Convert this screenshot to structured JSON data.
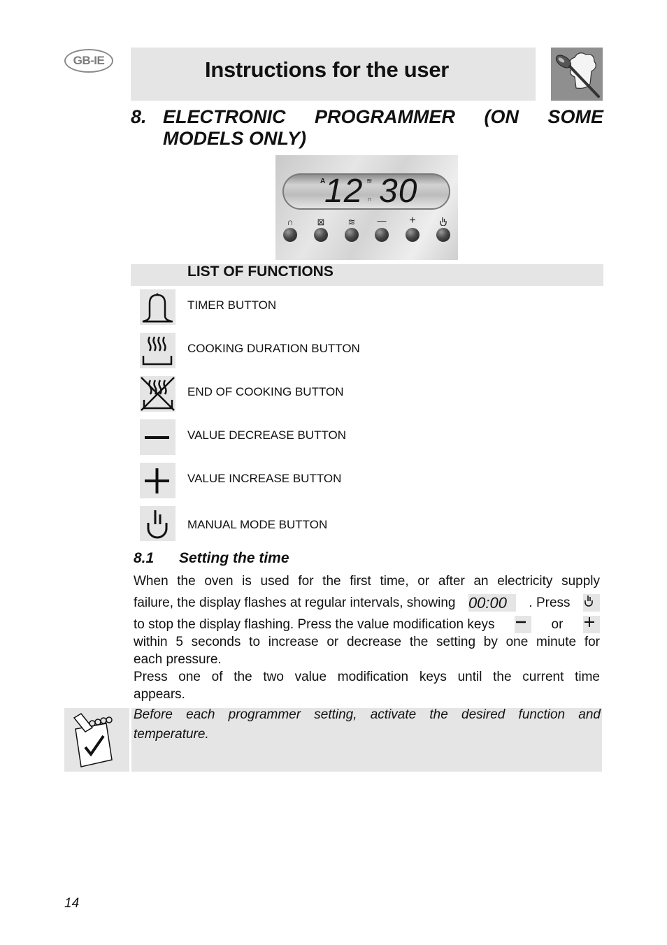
{
  "header": {
    "region_badge": "GB-IE",
    "title": "Instructions for the user",
    "logo_icon": "chef-hat-spoon-icon"
  },
  "section": {
    "number": "8.",
    "title_line1_words": [
      "ELECTRONIC",
      "PROGRAMMER",
      "(ON",
      "SOME"
    ],
    "title_line2": "MODELS ONLY)"
  },
  "control_panel": {
    "display_prefix": "A",
    "display_hours": "12",
    "display_minutes": "30",
    "buttons": [
      {
        "icon": "timer-bell-icon",
        "glyph": "⍝"
      },
      {
        "icon": "end-of-cooking-icon",
        "glyph": "⊠"
      },
      {
        "icon": "cooking-duration-icon",
        "glyph": "≋"
      },
      {
        "icon": "minus-icon",
        "glyph": "—"
      },
      {
        "icon": "plus-icon",
        "glyph": "+"
      },
      {
        "icon": "manual-hand-icon",
        "glyph": "ᗜ"
      }
    ]
  },
  "functions": {
    "heading": "LIST OF FUNCTIONS",
    "items": [
      {
        "icon": "timer-bell-icon",
        "label": "TIMER BUTTON"
      },
      {
        "icon": "cooking-duration-icon",
        "label": "COOKING DURATION BUTTON"
      },
      {
        "icon": "end-of-cooking-icon",
        "label": "END OF COOKING BUTTON"
      },
      {
        "icon": "minus-icon",
        "label": "VALUE DECREASE BUTTON"
      },
      {
        "icon": "plus-icon",
        "label": "VALUE INCREASE BUTTON"
      },
      {
        "icon": "manual-hand-icon",
        "label": "MANUAL MODE BUTTON"
      }
    ]
  },
  "setting_time": {
    "number": "8.1",
    "title": "Setting the time",
    "line1": "When the oven is used for the first time, or after an electricity supply",
    "line2_before": "failure, the display flashes at regular intervals, showing",
    "display_value": "00:00",
    "line2_after": ". Press",
    "line3_before": "to stop the display flashing. Press the value modification keys",
    "line3_or": "or",
    "line4": "within 5 seconds to increase or decrease the setting by one minute for",
    "line5": "each pressure.",
    "line6": "Press one of the two value modification keys until the current time",
    "line7": "appears."
  },
  "note": {
    "icon": "notepad-check-icon",
    "text_line1": "Before each programmer setting, activate the desired function and",
    "text_line2": "temperature."
  },
  "page_number": "14"
}
